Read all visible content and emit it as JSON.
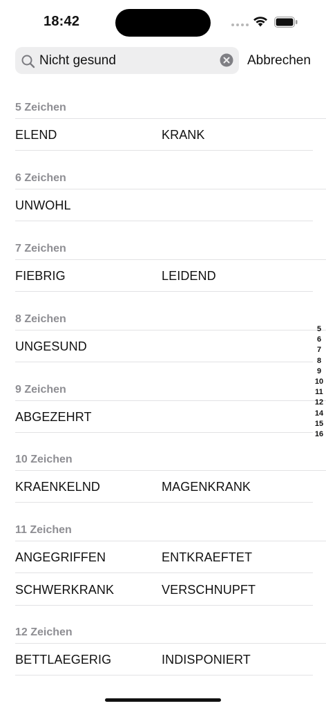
{
  "status_bar": {
    "time": "18:42"
  },
  "search": {
    "value": "Nicht gesund",
    "cancel_label": "Abbrechen"
  },
  "sections": [
    {
      "header": "5 Zeichen",
      "rows": [
        [
          "ELEND",
          "KRANK"
        ]
      ]
    },
    {
      "header": "6 Zeichen",
      "rows": [
        [
          "UNWOHL",
          ""
        ]
      ]
    },
    {
      "header": "7 Zeichen",
      "rows": [
        [
          "FIEBRIG",
          "LEIDEND"
        ]
      ]
    },
    {
      "header": "8 Zeichen",
      "rows": [
        [
          "UNGESUND",
          ""
        ]
      ]
    },
    {
      "header": "9 Zeichen",
      "rows": [
        [
          "ABGEZEHRT",
          ""
        ]
      ]
    },
    {
      "header": "10 Zeichen",
      "rows": [
        [
          "KRAENKELND",
          "MAGENKRANK"
        ]
      ]
    },
    {
      "header": "11 Zeichen",
      "rows": [
        [
          "ANGEGRIFFEN",
          "ENTKRAEFTET"
        ],
        [
          "SCHWERKRANK",
          "VERSCHNUPFT"
        ]
      ]
    },
    {
      "header": "12 Zeichen",
      "rows": [
        [
          "BETTLAEGERIG",
          "INDISPONIERT"
        ]
      ]
    }
  ],
  "index": [
    "5",
    "6",
    "7",
    "8",
    "9",
    "10",
    "11",
    "12",
    "14",
    "15",
    "16"
  ]
}
